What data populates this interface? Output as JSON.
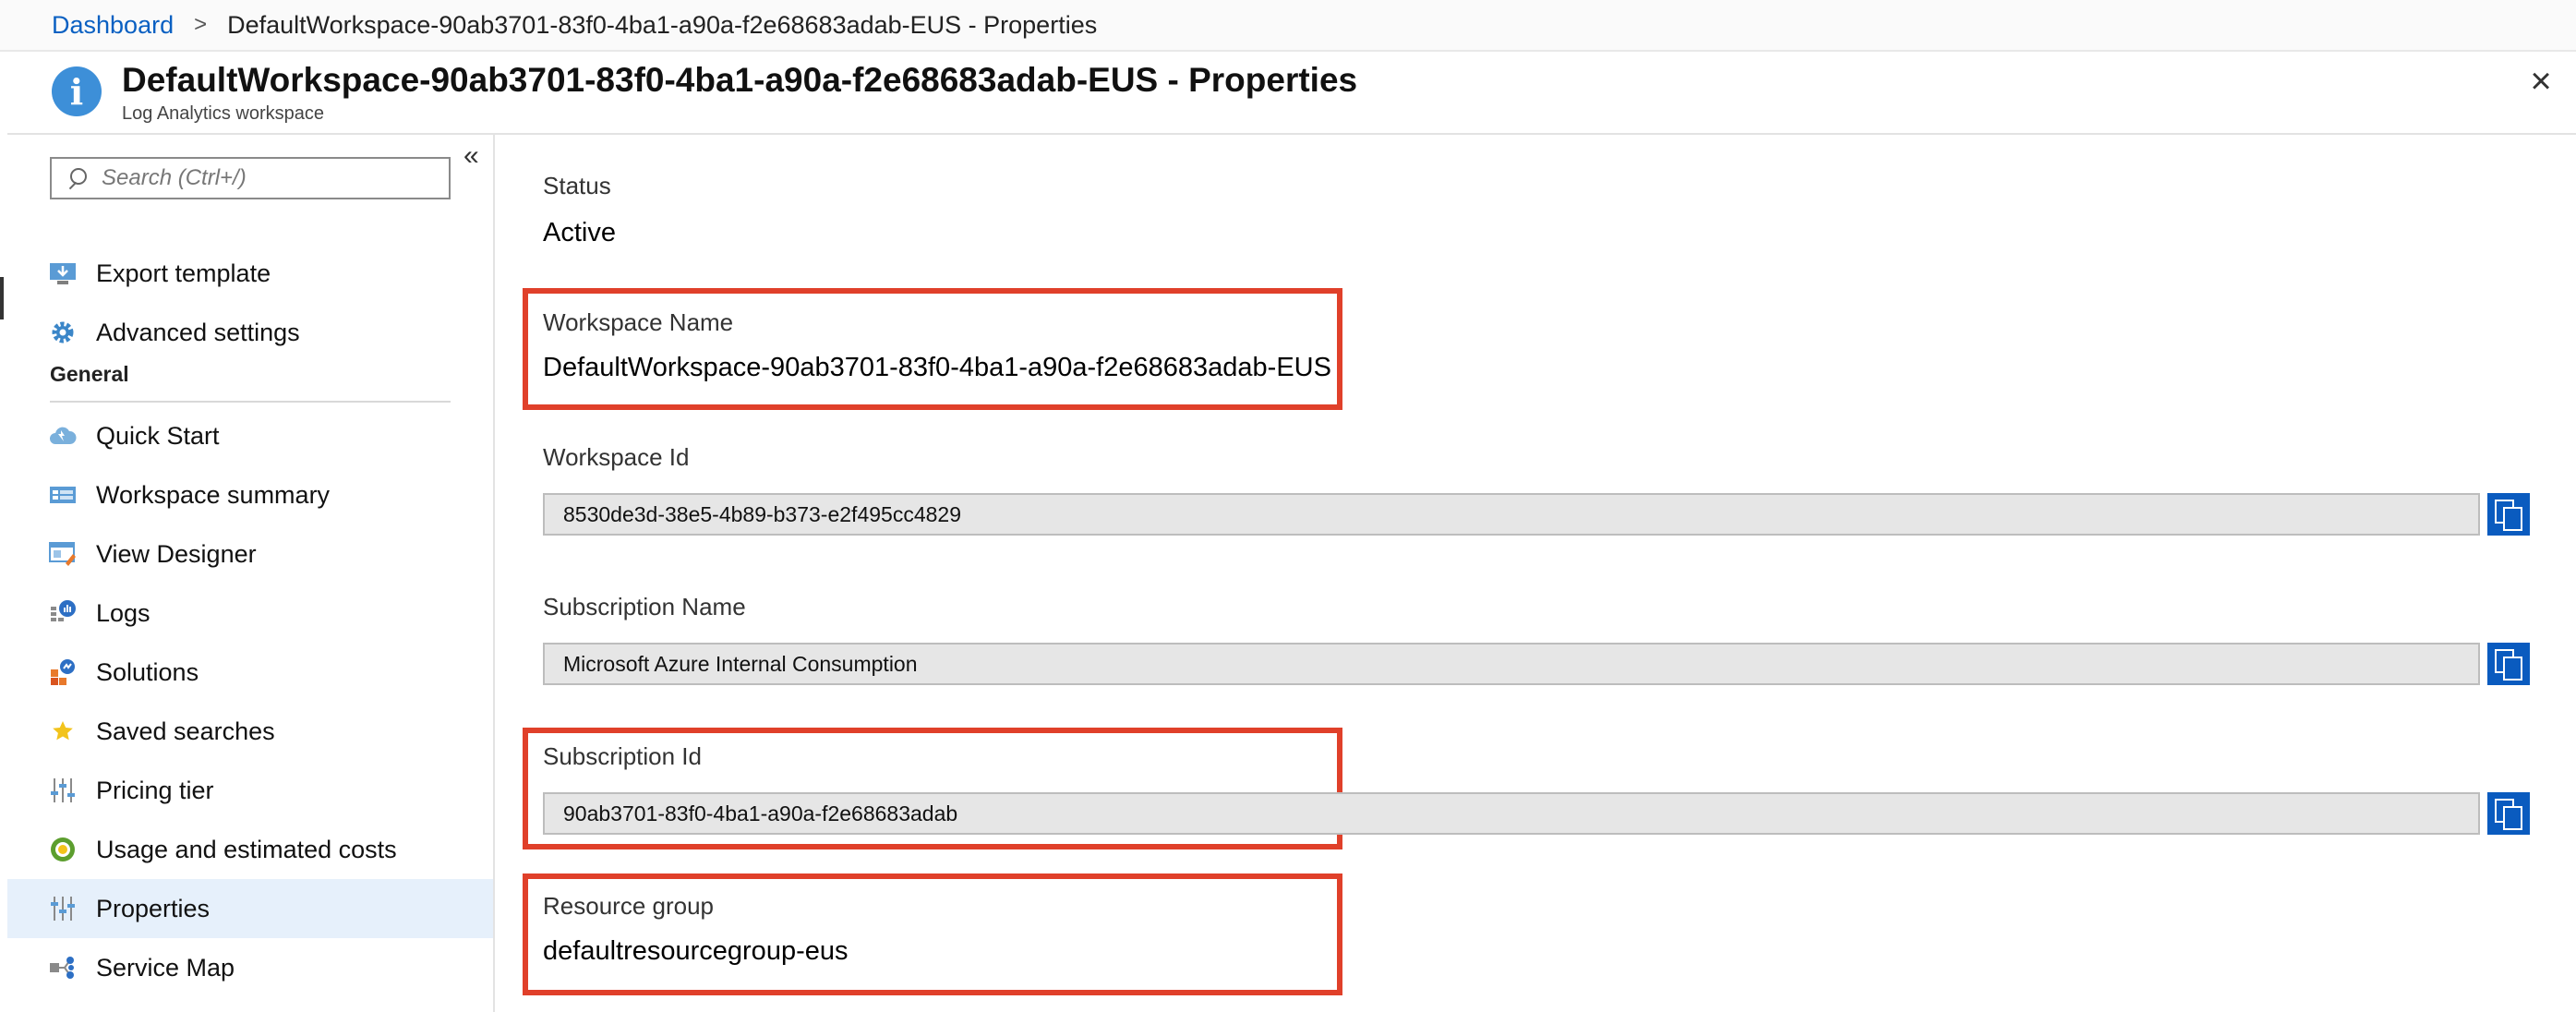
{
  "breadcrumb": {
    "root": "Dashboard",
    "separator": ">",
    "current": "DefaultWorkspace-90ab3701-83f0-4ba1-a90a-f2e68683adab-EUS - Properties"
  },
  "header": {
    "title": "DefaultWorkspace-90ab3701-83f0-4ba1-a90a-f2e68683adab-EUS - Properties",
    "subtitle": "Log Analytics workspace",
    "info_icon": "i",
    "close_icon": "×"
  },
  "sidebar": {
    "collapse_icon": "«",
    "search_placeholder": "Search (Ctrl+/)",
    "top_items": [
      {
        "label": "Export template",
        "icon": "export-template-icon"
      },
      {
        "label": "Advanced settings",
        "icon": "gear-icon"
      }
    ],
    "section_title": "General",
    "items": [
      {
        "label": "Quick Start",
        "icon": "cloud-icon"
      },
      {
        "label": "Workspace summary",
        "icon": "summary-icon"
      },
      {
        "label": "View Designer",
        "icon": "designer-icon"
      },
      {
        "label": "Logs",
        "icon": "logs-icon"
      },
      {
        "label": "Solutions",
        "icon": "solutions-icon"
      },
      {
        "label": "Saved searches",
        "icon": "star-icon"
      },
      {
        "label": "Pricing tier",
        "icon": "sliders-icon"
      },
      {
        "label": "Usage and estimated costs",
        "icon": "usage-icon"
      },
      {
        "label": "Properties",
        "icon": "properties-icon",
        "active": true
      },
      {
        "label": "Service Map",
        "icon": "service-map-icon"
      }
    ]
  },
  "properties": {
    "status_label": "Status",
    "status_value": "Active",
    "workspace_name_label": "Workspace Name",
    "workspace_name_value": "DefaultWorkspace-90ab3701-83f0-4ba1-a90a-f2e68683adab-EUS",
    "workspace_id_label": "Workspace Id",
    "workspace_id_value": "8530de3d-38e5-4b89-b373-e2f495cc4829",
    "subscription_name_label": "Subscription Name",
    "subscription_name_value": "Microsoft Azure Internal Consumption",
    "subscription_id_label": "Subscription Id",
    "subscription_id_value": "90ab3701-83f0-4ba1-a90a-f2e68683adab",
    "resource_group_label": "Resource group",
    "resource_group_value": "defaultresourcegroup-eus"
  },
  "colors": {
    "accent": "#0a5bbf",
    "link": "#0a60c2",
    "highlight": "#e0402a",
    "active_nav": "#e6f0fb"
  }
}
